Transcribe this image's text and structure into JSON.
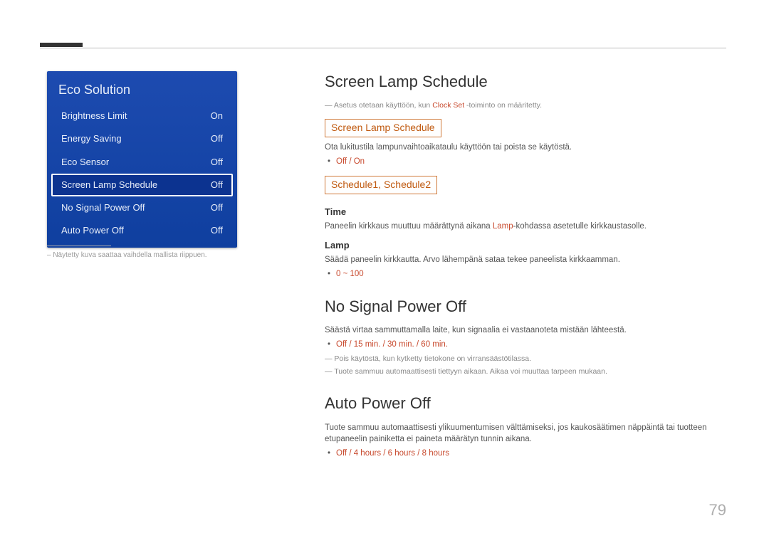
{
  "page_number": "79",
  "menu": {
    "title": "Eco Solution",
    "items": [
      {
        "label": "Brightness Limit",
        "value": "On",
        "selected": false
      },
      {
        "label": "Energy Saving",
        "value": "Off",
        "selected": false
      },
      {
        "label": "Eco Sensor",
        "value": "Off",
        "selected": false
      },
      {
        "label": "Screen Lamp Schedule",
        "value": "Off",
        "selected": true
      },
      {
        "label": "No Signal Power Off",
        "value": "Off",
        "selected": false
      },
      {
        "label": "Auto Power Off",
        "value": "Off",
        "selected": false
      }
    ],
    "note": "– Näytetty kuva saattaa vaihdella mallista riippuen."
  },
  "content": {
    "sls": {
      "heading": "Screen Lamp Schedule",
      "note_prefix": "Asetus otetaan käyttöön, kun ",
      "note_red": "Clock Set",
      "note_suffix": " -toiminto on määritetty.",
      "sub1_title": "Screen Lamp Schedule",
      "sub1_text": "Ota lukitustila lampunvaihtoaikataulu käyttöön tai poista se käytöstä.",
      "sub1_bullet": "Off / On",
      "sub2_title": "Schedule1, Schedule2",
      "time_h": "Time",
      "time_text_prefix": "Paneelin kirkkaus muuttuu määrättynä aikana ",
      "time_text_red": "Lamp",
      "time_text_suffix": "-kohdassa asetetulle kirkkaustasolle.",
      "lamp_h": "Lamp",
      "lamp_text": "Säädä paneelin kirkkautta. Arvo lähempänä sataa tekee paneelista kirkkaamman.",
      "lamp_bullet": "0 ~ 100"
    },
    "nspo": {
      "heading": "No Signal Power Off",
      "text": "Säästä virtaa sammuttamalla laite, kun signaalia ei vastaanoteta mistään lähteestä.",
      "bullet": "Off / 15 min. / 30 min. / 60 min.",
      "note1": "Pois käytöstä, kun kytketty tietokone on virransäästötilassa.",
      "note2": "Tuote sammuu automaattisesti tiettyyn aikaan. Aikaa voi muuttaa tarpeen mukaan."
    },
    "apo": {
      "heading": "Auto Power Off",
      "text": "Tuote sammuu automaattisesti ylikuumentumisen välttämiseksi, jos kaukosäätimen näppäintä tai tuotteen etupaneelin painiketta ei paineta määrätyn tunnin aikana.",
      "bullet": "Off / 4 hours / 6 hours / 8 hours"
    }
  }
}
